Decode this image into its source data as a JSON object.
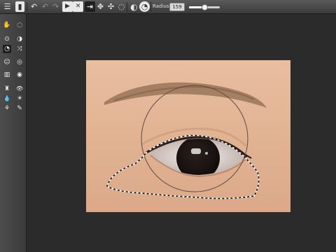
{
  "toolbar": {
    "radius_label": "Radius:",
    "radius_value": "159",
    "radius_slider_fraction": 0.5,
    "buttons": [
      {
        "name": "list-icon",
        "glyph": "☰"
      },
      {
        "name": "document-icon",
        "glyph": "▮"
      },
      {
        "name": "undo-icon",
        "glyph": "↶"
      },
      {
        "name": "undo-step-icon",
        "glyph": "↶"
      },
      {
        "name": "redo-icon",
        "glyph": "↷"
      },
      {
        "name": "play-icon",
        "glyph": "▶"
      },
      {
        "name": "close-icon",
        "glyph": "✕"
      },
      {
        "name": "move-in-icon",
        "glyph": "⇥"
      },
      {
        "name": "expand-arrows-icon",
        "glyph": "✥"
      },
      {
        "name": "pinwheel-icon",
        "glyph": "✣"
      },
      {
        "name": "lasso-icon",
        "glyph": "◌"
      },
      {
        "name": "half-circle-icon",
        "glyph": "◐"
      },
      {
        "name": "pie-icon",
        "glyph": "◔"
      }
    ]
  },
  "sidebar": {
    "tools": [
      {
        "name": "hand-icon",
        "glyph": "✋"
      },
      {
        "name": "lasso-select-icon",
        "glyph": "◌"
      },
      {
        "name": "dot-circle-icon",
        "glyph": "⊙"
      },
      {
        "name": "eye-reshape-icon",
        "glyph": "◑"
      },
      {
        "name": "clock-icon",
        "glyph": "◔"
      },
      {
        "name": "shuffle-icon",
        "glyph": "⤨"
      },
      {
        "name": "face-mask-icon",
        "glyph": "☺"
      },
      {
        "name": "lens-icon",
        "glyph": "◎"
      },
      {
        "name": "brush-comb-icon",
        "glyph": "▥"
      },
      {
        "name": "eye-icon",
        "glyph": "◉"
      },
      {
        "name": "stamp-icon",
        "glyph": "♜"
      },
      {
        "name": "view-eye-icon",
        "glyph": "👁"
      },
      {
        "name": "drop-icon",
        "glyph": "💧"
      },
      {
        "name": "sun-icon",
        "glyph": "☀"
      },
      {
        "name": "plant-icon",
        "glyph": "⚘"
      },
      {
        "name": "eraser-icon",
        "glyph": "✎"
      }
    ]
  },
  "colors": {
    "background": "#2b2b2b",
    "skin": "#e2b595",
    "iris": "#1a1614"
  }
}
